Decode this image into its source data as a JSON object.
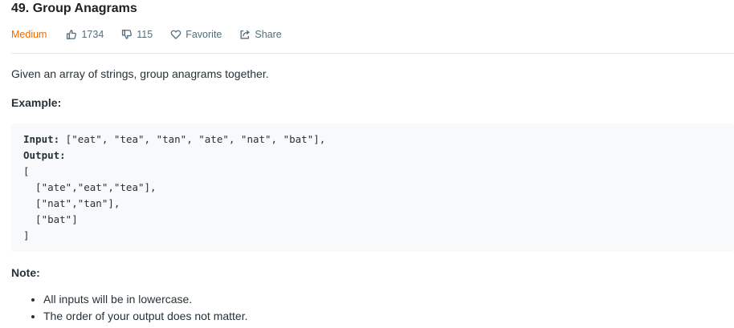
{
  "problem": {
    "title": "49. Group Anagrams",
    "difficulty": "Medium",
    "likes": "1734",
    "dislikes": "115",
    "favorite_label": "Favorite",
    "share_label": "Share"
  },
  "description": {
    "text": "Given an array of strings, group anagrams together.",
    "example_heading": "Example:",
    "example": {
      "input_label": "Input:",
      "input_value": " [\"eat\", \"tea\", \"tan\", \"ate\", \"nat\", \"bat\"],",
      "output_label": "Output:",
      "output_lines": [
        "[",
        "  [\"ate\",\"eat\",\"tea\"],",
        "  [\"nat\",\"tan\"],",
        "  [\"bat\"]",
        "]"
      ]
    },
    "note_heading": "Note:",
    "notes": [
      "All inputs will be in lowercase.",
      "The order of your output does not matter."
    ]
  },
  "colors": {
    "difficulty_medium": "#ef6c00",
    "code_background": "#f7f9fa",
    "meta_text": "#546e7a"
  },
  "icons": {
    "likes": "thumbs-up-icon",
    "dislikes": "thumbs-down-icon",
    "favorite": "heart-icon",
    "share": "share-icon"
  }
}
